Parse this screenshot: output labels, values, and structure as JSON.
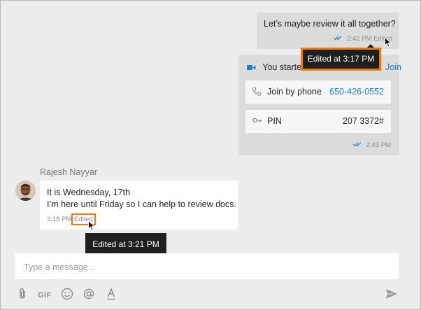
{
  "messages": {
    "outgoing_text": {
      "text": "Let’s maybe review it all together?",
      "time": "2:42 PM",
      "edited": "Edited"
    },
    "tooltip_outgoing": "Edited at 3:17 PM",
    "call_card": {
      "heading_prefix": "You started",
      "heading_link": "Join",
      "phone_label": "Join by phone",
      "phone_number": "650-426-0552",
      "pin_label": "PIN",
      "pin_value": "207 3372#",
      "time": "2:43 PM"
    },
    "incoming": {
      "sender": "Rajesh Nayyar",
      "line1": "It is Wednesday, 17th",
      "line2": "I’m here until Friday so I can help to review docs.",
      "time": "3:18 PM",
      "edited": "Edited"
    },
    "tooltip_incoming": "Edited at 3:21 PM"
  },
  "composer": {
    "placeholder": "Type a message..."
  },
  "toolbar": {
    "gif_label": "GIF"
  },
  "colors": {
    "accent_blue": "#1a7fd8",
    "highlight_orange": "#e87b13",
    "bubble_gray": "#dcdcdc",
    "background": "#ededed"
  },
  "icons": [
    "check-double-icon",
    "video-camera-icon",
    "phone-icon",
    "key-icon",
    "attachment-icon",
    "emoji-icon",
    "mention-icon",
    "text-format-icon",
    "send-icon",
    "mouse-cursor-icon"
  ]
}
